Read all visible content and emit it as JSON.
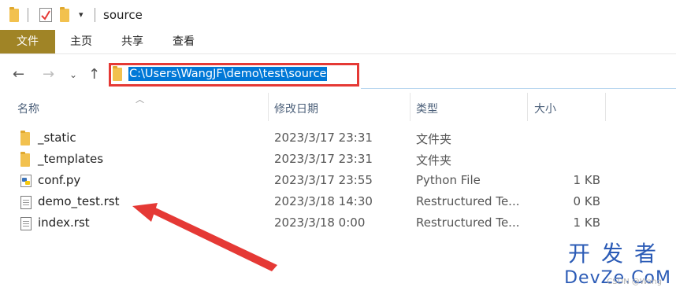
{
  "window": {
    "title": "source"
  },
  "ribbon": {
    "tabs": [
      "文件",
      "主页",
      "共享",
      "查看"
    ]
  },
  "address": {
    "path": "C:\\Users\\WangJF\\demo\\test\\source"
  },
  "columns": [
    "名称",
    "修改日期",
    "类型",
    "大小"
  ],
  "files": [
    {
      "name": "_static",
      "date": "2023/3/17 23:31",
      "type": "文件夹",
      "size": "",
      "icon": "folder-icon"
    },
    {
      "name": "_templates",
      "date": "2023/3/17 23:31",
      "type": "文件夹",
      "size": "",
      "icon": "folder-icon"
    },
    {
      "name": "conf.py",
      "date": "2023/3/17 23:55",
      "type": "Python File",
      "size": "1 KB",
      "icon": "python-file-icon"
    },
    {
      "name": "demo_test.rst",
      "date": "2023/3/18 14:30",
      "type": "Restructured Te...",
      "size": "0 KB",
      "icon": "document-icon"
    },
    {
      "name": "index.rst",
      "date": "2023/3/18 0:00",
      "type": "Restructured Te...",
      "size": "1 KB",
      "icon": "document-icon"
    }
  ],
  "watermark": {
    "chinese": "开发者",
    "latin": "DevZe.CoM",
    "small": "CSDN @Wang"
  },
  "colors": {
    "highlight_box": "#e53935",
    "file_tab": "#a08426",
    "selection": "#0078d7",
    "watermark": "#2b5bb6"
  }
}
